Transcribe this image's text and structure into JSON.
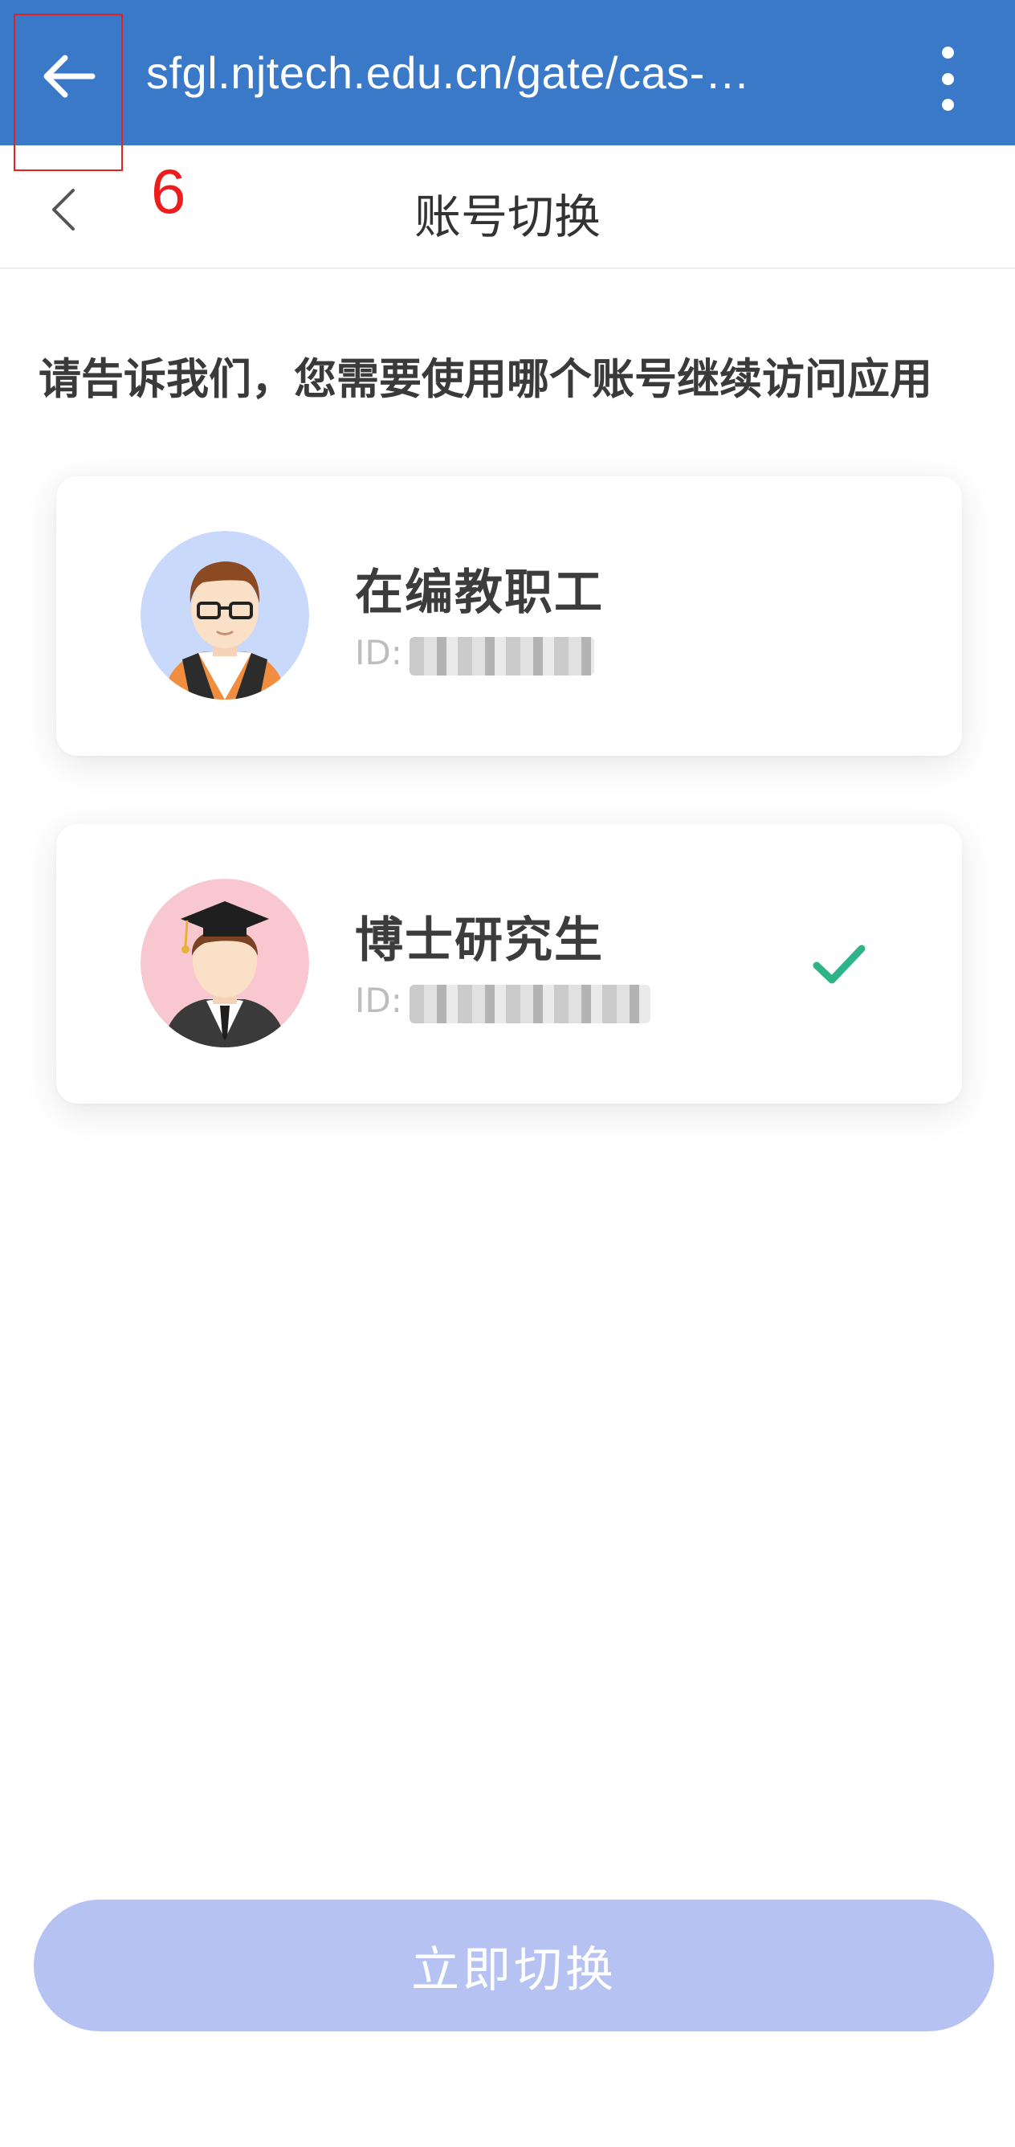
{
  "browser": {
    "url": "sfgl.njtech.edu.cn/gate/cas-…"
  },
  "annotation": {
    "number": "6"
  },
  "header": {
    "title": "账号切换"
  },
  "prompt": "请告诉我们，您需要使用哪个账号继续访问应用",
  "accounts": [
    {
      "name": "在编教职工",
      "id_label": "ID:",
      "avatar": "teacher-avatar-icon",
      "avatar_bg": "#c9d9fb",
      "selected": false
    },
    {
      "name": "博士研究生",
      "id_label": "ID:",
      "avatar": "graduate-avatar-icon",
      "avatar_bg": "#f9c7cf",
      "selected": true
    }
  ],
  "button": {
    "switch_label": "立即切换"
  },
  "colors": {
    "toolbar": "#3a78c8",
    "check": "#2fb489",
    "button_disabled": "#b6c3f2",
    "annotation": "#e52222"
  }
}
